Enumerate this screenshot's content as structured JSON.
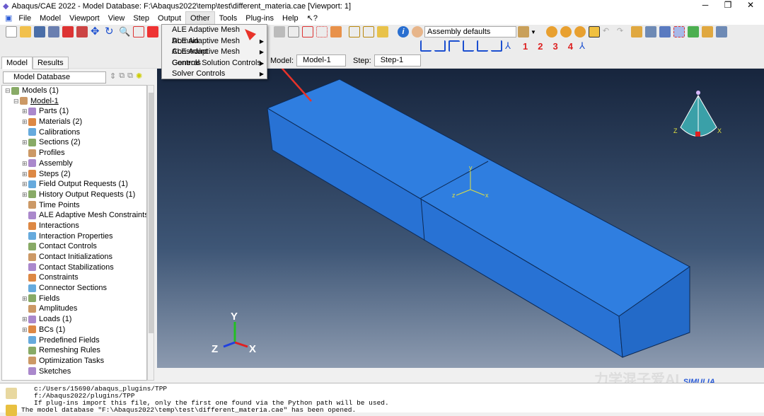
{
  "title": "Abaqus/CAE 2022 - Model Database: F:\\Abaqus2022\\temp\\test\\different_materia.cae [Viewport: 1]",
  "window_controls": [
    "─",
    "❐",
    "✕"
  ],
  "menu": [
    "File",
    "Model",
    "Viewport",
    "View",
    "Step",
    "Output",
    "Other",
    "Tools",
    "Plug-ins",
    "Help",
    "↖?"
  ],
  "other_menu": [
    "ALE Adaptive Mesh Domain",
    "ALE Adaptive Mesh Constraint",
    "ALE Adaptive Mesh Controls",
    "General Solution Controls",
    "Solver Controls"
  ],
  "render_style": "Assembly defaults",
  "view_numbers": [
    "1",
    "2",
    "3",
    "4"
  ],
  "context": {
    "model_label": "Model:",
    "model": "Model-1",
    "step_label": "Step:",
    "step": "Step-1"
  },
  "tabs": [
    "Model",
    "Results"
  ],
  "db_selector": "Model Database",
  "tree": [
    {
      "label": "Models (1)",
      "level": 0,
      "pm": "⊟"
    },
    {
      "label": "Model-1",
      "level": 1,
      "pm": "⊟"
    },
    {
      "label": "Parts (1)",
      "level": 2,
      "pm": "⊞"
    },
    {
      "label": "Materials (2)",
      "level": 2,
      "pm": "⊞"
    },
    {
      "label": "Calibrations",
      "level": 2,
      "pm": ""
    },
    {
      "label": "Sections (2)",
      "level": 2,
      "pm": "⊞"
    },
    {
      "label": "Profiles",
      "level": 2,
      "pm": ""
    },
    {
      "label": "Assembly",
      "level": 2,
      "pm": "⊞"
    },
    {
      "label": "Steps (2)",
      "level": 2,
      "pm": "⊞"
    },
    {
      "label": "Field Output Requests (1)",
      "level": 2,
      "pm": "⊞"
    },
    {
      "label": "History Output Requests (1)",
      "level": 2,
      "pm": "⊞"
    },
    {
      "label": "Time Points",
      "level": 2,
      "pm": ""
    },
    {
      "label": "ALE Adaptive Mesh Constraints",
      "level": 2,
      "pm": ""
    },
    {
      "label": "Interactions",
      "level": 2,
      "pm": ""
    },
    {
      "label": "Interaction Properties",
      "level": 2,
      "pm": ""
    },
    {
      "label": "Contact Controls",
      "level": 2,
      "pm": ""
    },
    {
      "label": "Contact Initializations",
      "level": 2,
      "pm": ""
    },
    {
      "label": "Contact Stabilizations",
      "level": 2,
      "pm": ""
    },
    {
      "label": "Constraints",
      "level": 2,
      "pm": ""
    },
    {
      "label": "Connector Sections",
      "level": 2,
      "pm": ""
    },
    {
      "label": "Fields",
      "level": 2,
      "pm": "⊞"
    },
    {
      "label": "Amplitudes",
      "level": 2,
      "pm": ""
    },
    {
      "label": "Loads (1)",
      "level": 2,
      "pm": "⊞"
    },
    {
      "label": "BCs (1)",
      "level": 2,
      "pm": "⊞"
    },
    {
      "label": "Predefined Fields",
      "level": 2,
      "pm": ""
    },
    {
      "label": "Remeshing Rules",
      "level": 2,
      "pm": ""
    },
    {
      "label": "Optimization Tasks",
      "level": 2,
      "pm": ""
    },
    {
      "label": "Sketches",
      "level": 2,
      "pm": ""
    }
  ],
  "triad": {
    "x": "X",
    "y": "Y",
    "z": "Z"
  },
  "csys": {
    "x": "x",
    "y": "y",
    "z": "z"
  },
  "messages": [
    "c:/Users/15690/abaqus_plugins/TPP",
    "f:/Abaqus2022/plugins/TPP",
    "If plug-ins import this file, only the first one found via the Python path will be used.",
    "The model database \"F:\\Abaqus2022\\temp\\test\\different_materia.cae\" has been opened."
  ],
  "watermark": "力学混子爱AI",
  "brand": "SIMULIA",
  "colors": {
    "part": "#2f7ee0",
    "viewport_top": "#17253d",
    "viewport_bottom": "#8d9bb0",
    "arrow": "#e8332a"
  }
}
